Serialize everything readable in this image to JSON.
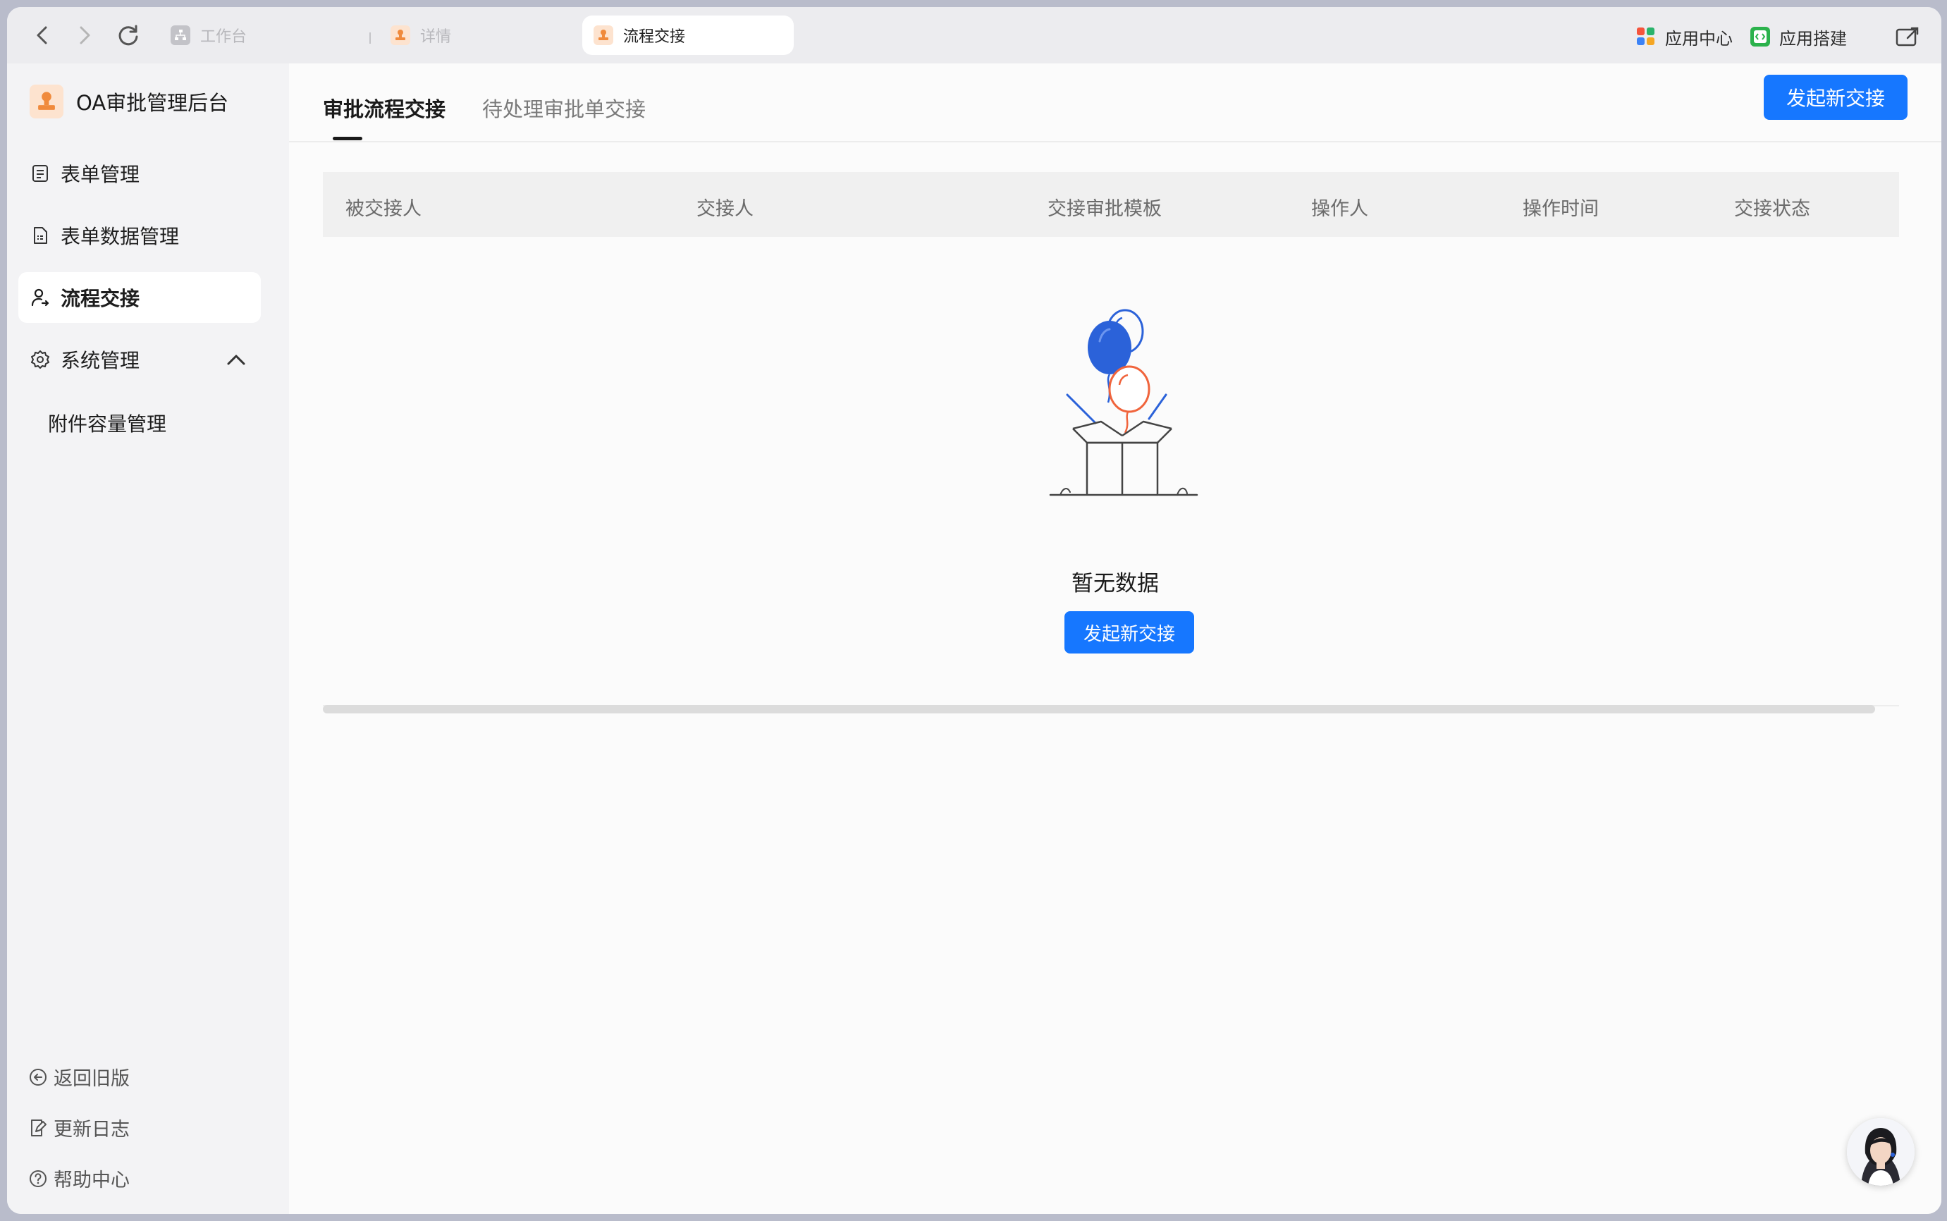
{
  "browser": {
    "tabs": [
      {
        "label": "工作台",
        "icon": "sitemap-icon"
      },
      {
        "label": "详情",
        "icon": "stamp-icon"
      },
      {
        "label": "流程交接",
        "icon": "stamp-icon"
      }
    ],
    "right_items": [
      {
        "label": "应用中心",
        "icon": "app-grid-icon"
      },
      {
        "label": "应用搭建",
        "icon": "code-icon"
      }
    ]
  },
  "sidebar": {
    "title": "OA审批管理后台",
    "menu": [
      {
        "label": "表单管理",
        "icon": "form-icon"
      },
      {
        "label": "表单数据管理",
        "icon": "document-icon"
      },
      {
        "label": "流程交接",
        "icon": "user-handover-icon",
        "active": true
      },
      {
        "label": "系统管理",
        "icon": "gear-icon",
        "expanded": true
      }
    ],
    "sub_menu": [
      {
        "label": "附件容量管理"
      }
    ],
    "footer": [
      {
        "label": "返回旧版",
        "icon": "back-circle-icon"
      },
      {
        "label": "更新日志",
        "icon": "edit-doc-icon"
      },
      {
        "label": "帮助中心",
        "icon": "help-icon"
      }
    ]
  },
  "main": {
    "tabs": [
      {
        "label": "审批流程交接",
        "active": true
      },
      {
        "label": "待处理审批单交接"
      }
    ],
    "primary_button": "发起新交接",
    "table_headers": [
      "被交接人",
      "交接人",
      "交接审批模板",
      "操作人",
      "操作时间",
      "交接状态"
    ],
    "empty_text": "暂无数据",
    "empty_button": "发起新交接"
  },
  "colors": {
    "primary": "#1677ff",
    "balloon_blue": "#2b62d9",
    "balloon_red": "#f0643c"
  }
}
